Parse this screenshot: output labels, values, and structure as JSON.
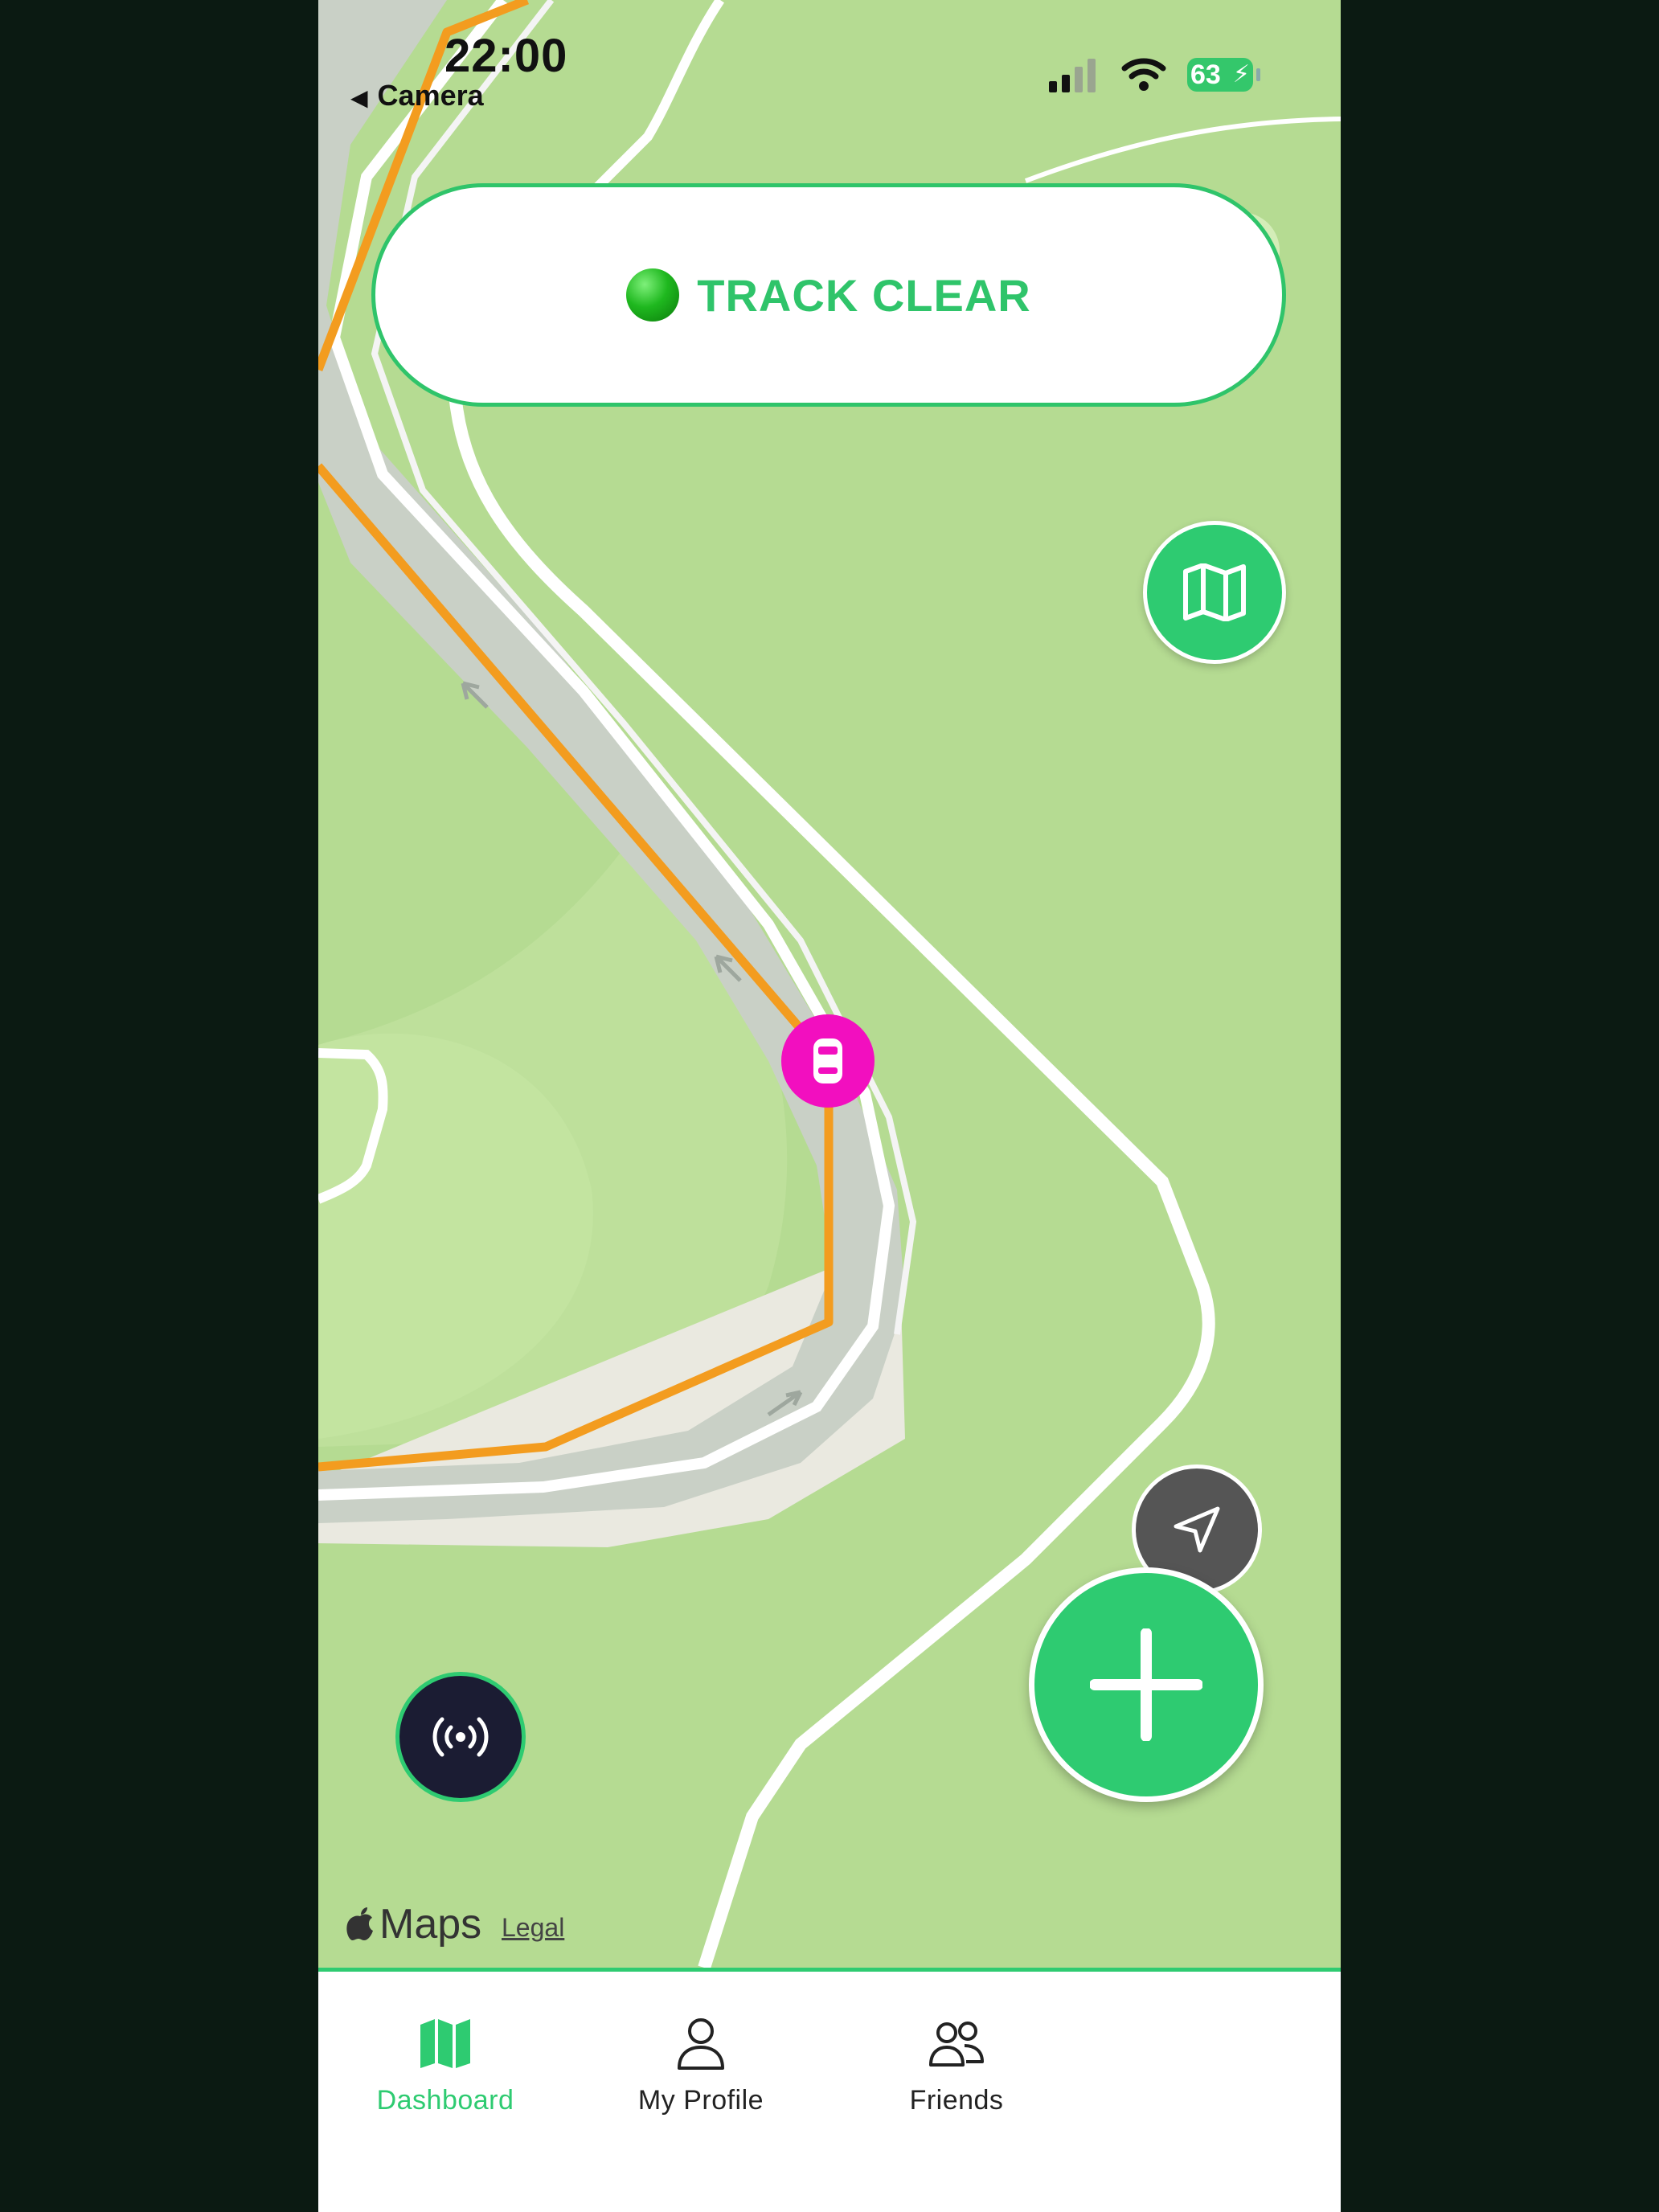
{
  "status_bar": {
    "time": "22:00",
    "back_label": "Camera",
    "battery_percent": "63"
  },
  "banner": {
    "status_text": "TRACK CLEAR",
    "status_color": "#2fc46a"
  },
  "map": {
    "attribution": "Maps",
    "legal_label": "Legal"
  },
  "tabs": [
    {
      "label": "Dashboard",
      "icon": "map-icon",
      "active": true
    },
    {
      "label": "My Profile",
      "icon": "person-icon",
      "active": false
    },
    {
      "label": "Friends",
      "icon": "people-icon",
      "active": false
    }
  ],
  "colors": {
    "accent": "#2ecb71",
    "route": "#f39c1f",
    "car_marker": "#f20fbf"
  }
}
